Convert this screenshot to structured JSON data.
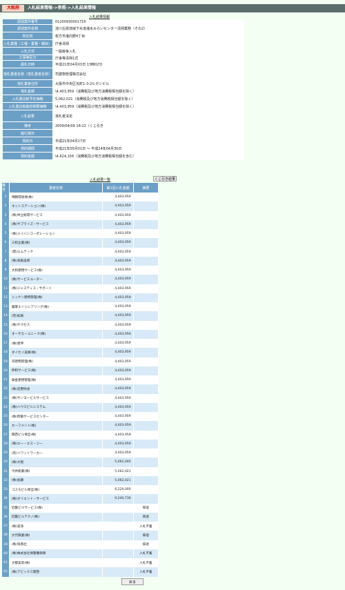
{
  "header": {
    "badge": "大阪府",
    "breadcrumb": "入札結果情報->参照->入札結果情報"
  },
  "info": {
    "heading": "入札結果情報",
    "rows": [
      {
        "label": "調達案件番号",
        "value": "01200930001716"
      },
      {
        "label": "調達案件名称",
        "value": "淀川左岸流域下水道渚水みらいセンター清掃業務（その2）"
      },
      {
        "label": "所在地",
        "value": "枚方市渚内野4丁目"
      },
      {
        "label": "入札業種（工種・業種・細目）",
        "value": "庁舎清掃"
      },
      {
        "label": "入札方式",
        "value": "一般競争入札"
      },
      {
        "label": "工事等区分",
        "value": "庁舎等清掃1式"
      },
      {
        "label": "開札日時",
        "value": "平成21年04月03日 13時02分"
      },
      {
        "label": "落札業者名称（落札業者名称）",
        "value": "司建物管理株式会社"
      },
      {
        "label": "落札業者住所",
        "value": "大阪市中央区瓦町1-3-2ヒガシビル"
      },
      {
        "label": "落札金額",
        "value": "\\4,403,959（消費税及び地方消費税相当額を除く）"
      },
      {
        "label": "入札書比較予定価格",
        "value": "5,062,021（消費税及び地方消費税相当額を除く）"
      },
      {
        "label": "入札書比較最低制限価格",
        "value": "\\4,403,959（消費税及び地方消費税相当額を除く）"
      },
      {
        "label": "入札結果",
        "value": "落札者決定"
      },
      {
        "label": "備考",
        "value": "2009/04/09 18:22（くじ引き"
      },
      {
        "label": "履行期日",
        "value": ""
      },
      {
        "label": "契約日",
        "value": "平成21年04月17日"
      },
      {
        "label": "契約期間",
        "value": "平成21年05月01日 ～ 平成24年04月30日"
      },
      {
        "label": "契約金額",
        "value": "\\4,624,156（消費税及び地方消費税相当額を含む）"
      }
    ]
  },
  "results": {
    "title": "入札結果一覧",
    "lottery_button": "くじ引き結果",
    "columns": [
      "番号",
      "業者名称",
      "第1回入札金額",
      "摘要"
    ],
    "rows": [
      {
        "no": "1",
        "name": "晴鶴環境保(株)",
        "amount": "4,403,959",
        "note": ""
      },
      {
        "no": "2",
        "name": "ネットステーション(株)",
        "amount": "4,403,959",
        "note": ""
      },
      {
        "no": "3",
        "name": "(株)共立総環サービス",
        "amount": "4,403,959",
        "note": ""
      },
      {
        "no": "4",
        "name": "(株)サプライズ・サービス",
        "amount": "4,403,959",
        "note": ""
      },
      {
        "no": "5",
        "name": "(株)メイハンコーポレーション",
        "amount": "4,403,959",
        "note": ""
      },
      {
        "no": "6",
        "name": "三和企業(株)",
        "amount": "4,403,959",
        "note": ""
      },
      {
        "no": "7",
        "name": "(資)エムテック",
        "amount": "4,403,959",
        "note": ""
      },
      {
        "no": "8",
        "name": "(株)高殿美術",
        "amount": "4,403,959",
        "note": ""
      },
      {
        "no": "9",
        "name": "大和建物サービス(株)",
        "amount": "4,403,959",
        "note": ""
      },
      {
        "no": "10",
        "name": "(株)サービスユーター",
        "amount": "4,403,959",
        "note": ""
      },
      {
        "no": "11",
        "name": "(株)ジャスティス・サポート",
        "amount": "4,403,959",
        "note": ""
      },
      {
        "no": "12",
        "name": "ニッケン建物管理(株)",
        "amount": "4,403,959",
        "note": ""
      },
      {
        "no": "13",
        "name": "薩摩エンジニアリング(株)",
        "amount": "4,403,959",
        "note": ""
      },
      {
        "no": "14",
        "name": "(有)如真",
        "amount": "4,403,959",
        "note": ""
      },
      {
        "no": "15",
        "name": "(株)サクセス",
        "amount": "4,403,959",
        "note": ""
      },
      {
        "no": "16",
        "name": "オーサカ・ユニーク(株)",
        "amount": "4,403,959",
        "note": ""
      },
      {
        "no": "17",
        "name": "(株)恵伸",
        "amount": "4,403,959",
        "note": ""
      },
      {
        "no": "18",
        "name": "ダイセイ美庫(株)",
        "amount": "4,403,959",
        "note": ""
      },
      {
        "no": "19",
        "name": "司建物管理(株)",
        "amount": "4,403,959",
        "note": ""
      },
      {
        "no": "20",
        "name": "伸和サービス(株)",
        "amount": "4,403,959",
        "note": ""
      },
      {
        "no": "21",
        "name": "鋳金建物管理(株)",
        "amount": "4,403,959",
        "note": ""
      },
      {
        "no": "22",
        "name": "(株)宮野商会",
        "amount": "4,403,959",
        "note": ""
      },
      {
        "no": "23",
        "name": "(株)サンヨービルサービス",
        "amount": "4,403,959",
        "note": ""
      },
      {
        "no": "24",
        "name": "(株)ハウスビルシステム",
        "amount": "4,403,959",
        "note": ""
      },
      {
        "no": "25",
        "name": "(株)岡重サービスセンター",
        "amount": "4,403,959",
        "note": ""
      },
      {
        "no": "26",
        "name": "セーフメント(株)",
        "amount": "4,403,959",
        "note": ""
      },
      {
        "no": "27",
        "name": "関西ビル保全(株)",
        "amount": "4,403,959",
        "note": ""
      },
      {
        "no": "28",
        "name": "(株)エー・エス・ジー",
        "amount": "4,403,959",
        "note": ""
      },
      {
        "no": "29",
        "name": "(有)ソワットワーカー",
        "amount": "4,403,959",
        "note": ""
      },
      {
        "no": "30",
        "name": "(株)大阪",
        "amount": "5,062,000",
        "note": ""
      },
      {
        "no": "31",
        "name": "今井総業(株)",
        "amount": "5,062,021",
        "note": ""
      },
      {
        "no": "32",
        "name": "(株)加藤",
        "amount": "5,062,021",
        "note": ""
      },
      {
        "no": "33",
        "name": "コスモビル保全(株)",
        "amount": "6,229,000",
        "note": ""
      },
      {
        "no": "34",
        "name": "(株)オリエント・サービス",
        "amount": "9,240,736",
        "note": ""
      },
      {
        "no": "35",
        "name": "近畿ビルサービス(株)",
        "amount": "",
        "note": "辞退"
      },
      {
        "no": "36",
        "name": "近畿ビルテクノ(株)",
        "amount": "",
        "note": "辞退"
      },
      {
        "no": "37",
        "name": "(株)美浄",
        "amount": "",
        "note": "入札不着"
      },
      {
        "no": "38",
        "name": "大代興業(株)",
        "amount": "",
        "note": "辞退"
      },
      {
        "no": "39",
        "name": "(株)浄香社",
        "amount": "",
        "note": "辞退"
      },
      {
        "no": "40",
        "name": "(株)株式会社保警備保障",
        "amount": "",
        "note": "入札不着"
      },
      {
        "no": "41",
        "name": "大都美装(株)",
        "amount": "",
        "note": "入札不着"
      },
      {
        "no": "42",
        "name": "(株)アビックス関西",
        "amount": "",
        "note": "入札不着"
      }
    ]
  },
  "footer": {
    "back_button": "戻る"
  }
}
